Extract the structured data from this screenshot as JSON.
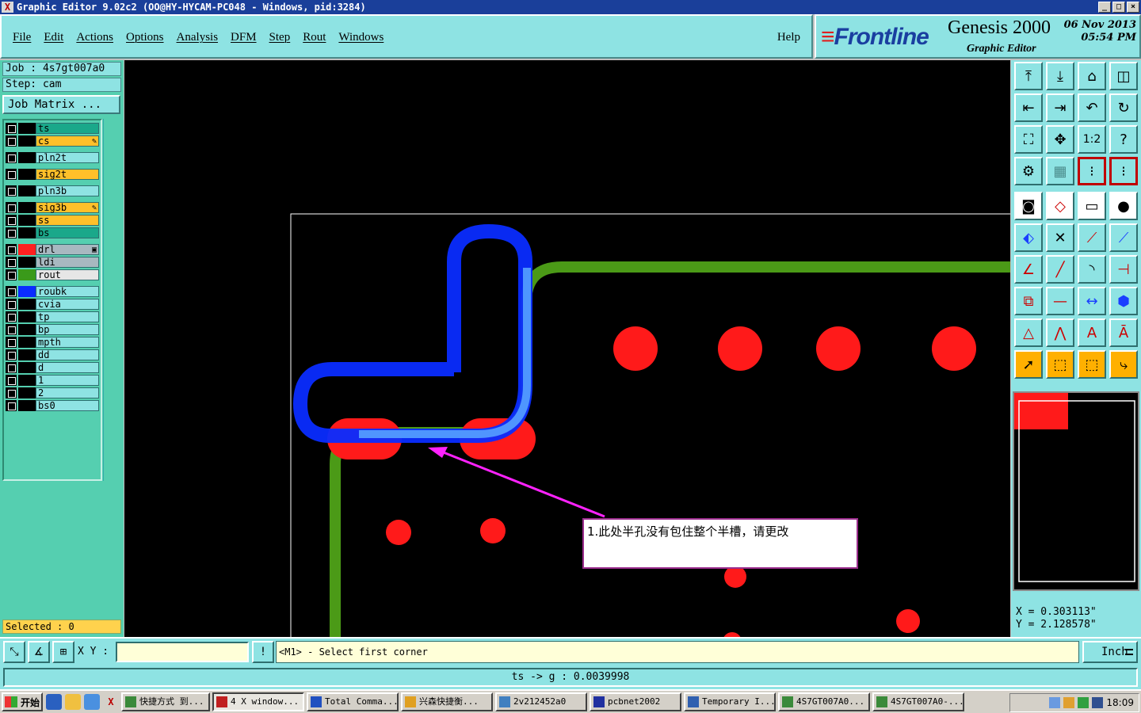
{
  "window": {
    "title": "Graphic Editor 9.02c2  (OO@HY-HYCAM-PC048 - Windows, pid:3284)",
    "buttons": [
      "_",
      "□",
      "×"
    ]
  },
  "menu": {
    "items": [
      "File",
      "Edit",
      "Actions",
      "Options",
      "Analysis",
      "DFM",
      "Step",
      "Rout",
      "Windows"
    ],
    "help": "Help"
  },
  "logo": {
    "brand": "Frontline",
    "product": "Genesis 2000",
    "subtitle": "Graphic Editor",
    "date": "06 Nov 2013",
    "time": "05:54 PM"
  },
  "job": {
    "job_line": "Job : 4s7gt007a0",
    "step_line": "Step: cam",
    "matrix_button": "Job Matrix ..."
  },
  "layers": [
    {
      "name": "ts",
      "bg": "#1aa88a",
      "color": "#000000",
      "mark": ""
    },
    {
      "name": "cs",
      "bg": "#ffc02a",
      "color": "#000000",
      "mark": "✎"
    },
    {
      "name": "pln2t",
      "bg": "#8ee3e3",
      "color": "#000000",
      "mark": ""
    },
    {
      "name": "sig2t",
      "bg": "#ffc02a",
      "color": "#000000",
      "mark": ""
    },
    {
      "name": "pln3b",
      "bg": "#8ee3e3",
      "color": "#000000",
      "mark": ""
    },
    {
      "name": "sig3b",
      "bg": "#ffc02a",
      "color": "#000000",
      "mark": "✎"
    },
    {
      "name": "ss",
      "bg": "#ffc02a",
      "color": "#000000",
      "mark": ""
    },
    {
      "name": "bs",
      "bg": "#1aa88a",
      "color": "#000000",
      "mark": ""
    },
    {
      "name": "drl",
      "bg": "#a8b8c0",
      "color": "#ff2020",
      "mark": "▣"
    },
    {
      "name": "ldi",
      "bg": "#a8b8c0",
      "color": "#000000",
      "mark": ""
    },
    {
      "name": "rout",
      "bg": "#e6e6e6",
      "color": "#3a9a1a",
      "mark": ""
    },
    {
      "name": "roubk",
      "bg": "#8ee3e3",
      "color": "#0a2cff",
      "mark": ""
    },
    {
      "name": "cvia",
      "bg": "#8ee3e3",
      "color": "#000000",
      "mark": ""
    },
    {
      "name": "tp",
      "bg": "#8ee3e3",
      "color": "#000000",
      "mark": ""
    },
    {
      "name": "bp",
      "bg": "#8ee3e3",
      "color": "#000000",
      "mark": ""
    },
    {
      "name": "mpth",
      "bg": "#8ee3e3",
      "color": "#000000",
      "mark": ""
    },
    {
      "name": "dd",
      "bg": "#8ee3e3",
      "color": "#000000",
      "mark": ""
    },
    {
      "name": "d",
      "bg": "#8ee3e3",
      "color": "#000000",
      "mark": ""
    },
    {
      "name": "1",
      "bg": "#8ee3e3",
      "color": "#000000",
      "mark": ""
    },
    {
      "name": "2",
      "bg": "#8ee3e3",
      "color": "#000000",
      "mark": ""
    },
    {
      "name": "bs0",
      "bg": "#8ee3e3",
      "color": "#000000",
      "mark": ""
    }
  ],
  "selected": "Selected : 0",
  "annotation": "1.此处半孔没有包住整个半槽，请更改",
  "coords": {
    "x": "X = 0.303113\"",
    "y": "Y = 2.128578\""
  },
  "command": {
    "xy_label": "X Y :",
    "xy_value": "",
    "prompt": "<M1> - Select first corner",
    "unit": "Inch"
  },
  "status": "ts -> g : 0.0039998",
  "taskbar": {
    "start": "开始",
    "tasks": [
      {
        "label": "快捷方式 到...",
        "icon": "#3a8a3a"
      },
      {
        "label": "4 X window...",
        "icon": "#c02020"
      },
      {
        "label": "Total Comma...",
        "icon": "#2050c0"
      },
      {
        "label": "兴森快捷衡...",
        "icon": "#e0a020"
      },
      {
        "label": "2v212452a0",
        "icon": "#4080c0"
      },
      {
        "label": "pcbnet2002",
        "icon": "#2030a0"
      },
      {
        "label": "Temporary I...",
        "icon": "#3060b0"
      },
      {
        "label": "4S7GT007A0...",
        "icon": "#3a8a3a"
      },
      {
        "label": "4S7GT007A0-...",
        "icon": "#3a8a3a"
      }
    ],
    "clock": "18:09"
  },
  "colors": {
    "panel": "#8ee3e3",
    "layer_panel": "#55cfb0",
    "canvas": "#000000",
    "pad_red": "#ff1a1a",
    "rout_green": "#4b9a17",
    "roubk_blue": "#0a2cff"
  }
}
